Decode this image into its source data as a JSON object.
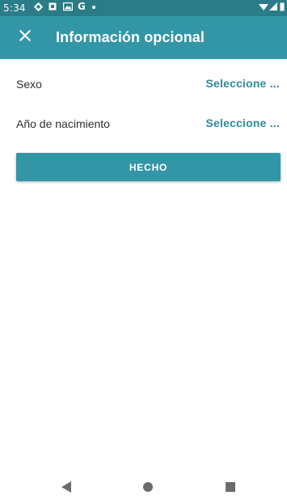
{
  "status_bar": {
    "time": "5:34",
    "icons": [
      "gear-icon",
      "notification-icon",
      "photo-icon",
      "google-icon",
      "dot-icon",
      "wifi-icon",
      "signal-icon",
      "battery-icon"
    ]
  },
  "toolbar": {
    "title": "Información opcional",
    "close_icon": "close-icon",
    "background": "#3296a6"
  },
  "form": {
    "fields": [
      {
        "label": "Sexo",
        "value": "Seleccione ..."
      },
      {
        "label": "Año de nacimiento",
        "value": "Seleccione ..."
      }
    ],
    "done_label": "HECHO"
  },
  "nav_bar": {
    "buttons": [
      "back-icon",
      "home-icon",
      "recents-icon"
    ]
  },
  "colors": {
    "accent": "#3296a6",
    "status_bar": "#2a7c86",
    "value_text": "#2f8a9b"
  }
}
